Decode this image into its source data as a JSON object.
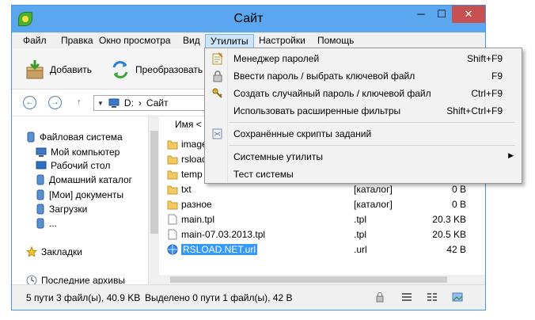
{
  "window": {
    "title": "Сайт",
    "close_glyph": "✕",
    "minimize_glyph": "─",
    "maximize_glyph": "☐",
    "accent": "#5aa7f0"
  },
  "menubar": {
    "items": [
      "Файл",
      "Правка",
      "Окно просмотра",
      "Вид",
      "Утилиты",
      "Настройки",
      "Помощь"
    ],
    "active": "Утилиты"
  },
  "toolbar": {
    "add_label": "Добавить",
    "convert_label": "Преобразовать"
  },
  "address": {
    "drive": "D:",
    "separator": "›",
    "folder": "Сайт",
    "back_glyph": "←",
    "forward_glyph": "→",
    "up_glyph": "↑",
    "dropdown_glyph": "▼"
  },
  "tree": {
    "items": [
      {
        "label": "Файловая система",
        "icon": "book-icon"
      },
      {
        "label": "Мой компьютер",
        "icon": "computer-icon"
      },
      {
        "label": "Рабочий стол",
        "icon": "desktop-icon"
      },
      {
        "label": "Домашний каталог",
        "icon": "book-icon"
      },
      {
        "label": "[Мои] документы",
        "icon": "book-icon"
      },
      {
        "label": "Загрузки",
        "icon": "book-icon"
      },
      {
        "label": "...",
        "icon": "book-icon"
      },
      {
        "label": "Закладки",
        "icon": "star-icon"
      },
      {
        "label": "Последние архивы",
        "icon": "clock-icon"
      }
    ]
  },
  "filelist": {
    "header_name": "Имя <",
    "rows": [
      {
        "name": "images",
        "ext": "",
        "size": "",
        "type": "folder"
      },
      {
        "name": "rsload",
        "ext": "",
        "size": "",
        "type": "folder"
      },
      {
        "name": "temp",
        "ext": "",
        "size": "",
        "type": "folder"
      },
      {
        "name": "txt",
        "ext": "",
        "size": "",
        "type": "folder"
      },
      {
        "name": "разное",
        "ext": "[каталог]",
        "size": "0 B",
        "type": "folder"
      },
      {
        "name": "main.tpl",
        "ext": ".tpl",
        "size": "20.3 KB",
        "type": "file"
      },
      {
        "name": "main-07.03.2013.tpl",
        "ext": ".tpl",
        "size": "20.5 KB",
        "type": "file"
      },
      {
        "name": "RSLOAD.NET.url",
        "ext": ".url",
        "size": "42 B",
        "type": "url"
      }
    ],
    "hidden_rows": [
      {
        "ext": "[каталог]",
        "size": "0 B"
      }
    ]
  },
  "status": {
    "left": "5 пути 3 файл(ы), 40.9 KB",
    "middle": "Выделено 0 пути 1 файл(ы), 42 B"
  },
  "utilities_menu": {
    "items": [
      {
        "label": "Менеджер паролей",
        "shortcut": "Shift+F9",
        "icon": "notepad-icon"
      },
      {
        "label": "Ввести пароль / выбрать ключевой файл",
        "shortcut": "F9",
        "icon": "lock-icon"
      },
      {
        "label": "Создать случайный пароль / ключевой файл",
        "shortcut": "Ctrl+F9",
        "icon": "key-tools-icon"
      },
      {
        "label": "Использовать расширенные фильтры",
        "shortcut": "Shift+Ctrl+F9",
        "icon": ""
      },
      {
        "label": "Сохранённые скрипты заданий",
        "shortcut": "",
        "icon": "script-icon"
      },
      {
        "label": "Системные утилиты",
        "shortcut": "",
        "icon": "",
        "submenu": true
      },
      {
        "label": "Тест системы",
        "shortcut": "",
        "icon": ""
      }
    ],
    "submenu_glyph": "▶"
  }
}
